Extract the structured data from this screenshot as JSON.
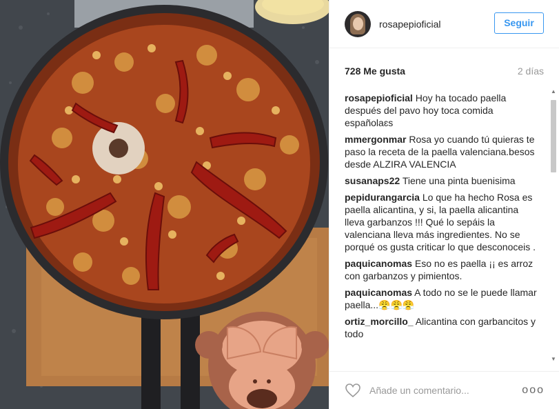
{
  "post": {
    "image_icon": "paella-photo",
    "overlay_emoji": "see-no-evil-monkey-icon"
  },
  "header": {
    "username": "rosapepioficial",
    "follow_label": "Seguir"
  },
  "meta": {
    "likes": "728 Me gusta",
    "time_ago": "2 días"
  },
  "comments": [
    {
      "user": "rosapepioficial",
      "text": "Hoy ha tocado paella después del pavo hoy toca comida españolaɛs"
    },
    {
      "user": "mmergonmar",
      "text": "Rosa yo cuando tú quieras te paso la receta de la paella valenciana.besos desde ALZIRA VALENCIA"
    },
    {
      "user": "susanaps22",
      "text": "Tiene una pinta buenisima"
    },
    {
      "user": "pepidurangarcia",
      "text": "Lo que ha hecho Rosa es paella alicantina, y si, la paella alicantina lleva garbanzos !!! Qué lo sepáis la valenciana lleva más ingredientes. No se porqué os gusta criticar lo que desconoceis ."
    },
    {
      "user": "paquicanomas",
      "text": "Eso no es paella ¡¡ es arroz con garbanzos y pimientos."
    },
    {
      "user": "paquicanomas",
      "text": "A todo no se le puede llamar paella...😤😤😤"
    },
    {
      "user": "ortiz_morcillo_",
      "text": "Alicantina con garbancitos y todo"
    }
  ],
  "footer": {
    "comment_placeholder": "Añade un comentario...",
    "more_label": "ooo",
    "heart_icon": "heart-icon"
  },
  "colors": {
    "accent": "#3897f0",
    "text": "#262626",
    "muted": "#999999"
  }
}
